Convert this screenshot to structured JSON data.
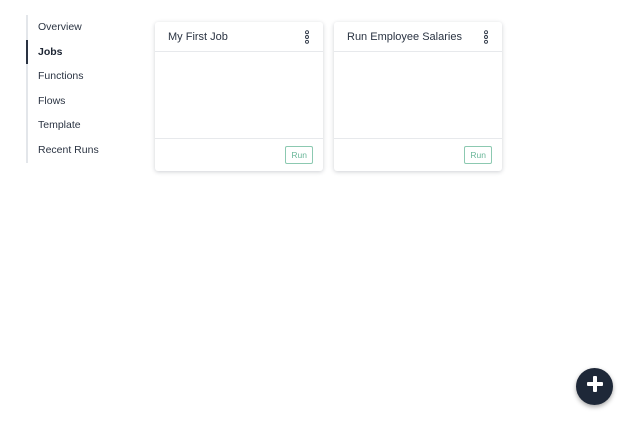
{
  "sidebar": {
    "items": [
      {
        "label": "Overview",
        "active": false
      },
      {
        "label": "Jobs",
        "active": true
      },
      {
        "label": "Functions",
        "active": false
      },
      {
        "label": "Flows",
        "active": false
      },
      {
        "label": "Template",
        "active": false
      },
      {
        "label": "Recent Runs",
        "active": false
      }
    ]
  },
  "jobs": [
    {
      "title": "My First Job",
      "menu_icon": "more-vertical-icon",
      "run_label": "Run"
    },
    {
      "title": "Run Employee Salaries",
      "menu_icon": "more-vertical-icon",
      "run_label": "Run"
    }
  ],
  "fab": {
    "icon": "plus-icon"
  },
  "colors": {
    "text": "#2a3342",
    "accent_dark": "#1e2838",
    "run_green": "#6bb79a",
    "run_border": "#8cc9b1",
    "divider": "#e7e9ec"
  }
}
